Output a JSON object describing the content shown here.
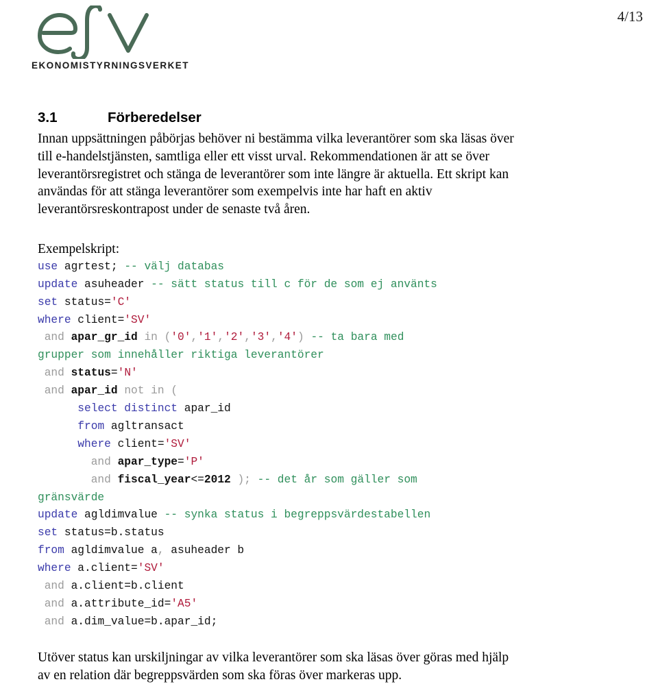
{
  "header": {
    "page_number": "4/13",
    "logo": {
      "mark_text": "esv",
      "wordmark": "EKONOMISTYRNINGSVERKET",
      "color": "#4a6b57"
    }
  },
  "content": {
    "section": {
      "number": "3.1",
      "title": "Förberedelser"
    },
    "intro_paragraph": "Innan uppsättningen påbörjas behöver ni bestämma vilka leverantörer som ska läsas över till e-handelstjänsten, samtliga eller ett visst urval. Rekommendationen är att se över leverantörsregistret och stänga de leverantörer som inte längre är aktuella. Ett skript kan användas för att stänga leverantörer som exempelvis inte har haft en aktiv leverantörsreskontrapost under de senaste två åren.",
    "script_label": "Exempelskript:",
    "outro_paragraph": "Utöver status kan urskiljningar av vilka leverantörer som ska läsas över göras med hjälp av en relation där begreppsvärden som ska föras över markeras upp.",
    "code": {
      "language": "sql",
      "colors": {
        "keyword": "#3a3aaa",
        "keyword_secondary": "#9a9a9a",
        "identifier": "#111111",
        "string": "#b01c3c",
        "comment": "#2f8f5b",
        "punctuation": "#9a9a9a"
      },
      "lines": [
        [
          {
            "t": "use",
            "c": "kw"
          },
          {
            "t": " agrtest; ",
            "c": "plain"
          },
          {
            "t": "-- välj databas",
            "c": "com"
          }
        ],
        [
          {
            "t": "update",
            "c": "kw"
          },
          {
            "t": " asuheader ",
            "c": "plain"
          },
          {
            "t": "-- sätt status till c för de som ej använts",
            "c": "com"
          }
        ],
        [
          {
            "t": "set",
            "c": "kw"
          },
          {
            "t": " status=",
            "c": "plain"
          },
          {
            "t": "'C'",
            "c": "str"
          }
        ],
        [
          {
            "t": "where",
            "c": "kw"
          },
          {
            "t": " client=",
            "c": "plain"
          },
          {
            "t": "'SV'",
            "c": "str"
          }
        ],
        [
          {
            "t": " ",
            "c": "plain"
          },
          {
            "t": "and",
            "c": "kw2"
          },
          {
            "t": " ",
            "c": "plain"
          },
          {
            "t": "apar_gr_id",
            "c": "id"
          },
          {
            "t": " ",
            "c": "plain"
          },
          {
            "t": "in",
            "c": "kw2"
          },
          {
            "t": " ",
            "c": "plain"
          },
          {
            "t": "(",
            "c": "punct"
          },
          {
            "t": "'0'",
            "c": "str"
          },
          {
            "t": ",",
            "c": "punct"
          },
          {
            "t": "'1'",
            "c": "str"
          },
          {
            "t": ",",
            "c": "punct"
          },
          {
            "t": "'2'",
            "c": "str"
          },
          {
            "t": ",",
            "c": "punct"
          },
          {
            "t": "'3'",
            "c": "str"
          },
          {
            "t": ",",
            "c": "punct"
          },
          {
            "t": "'4'",
            "c": "str"
          },
          {
            "t": ")",
            "c": "punct"
          },
          {
            "t": " ",
            "c": "plain"
          },
          {
            "t": "-- ta bara med",
            "c": "com"
          }
        ],
        [
          {
            "t": "grupper som innehåller riktiga leverantörer",
            "c": "com"
          }
        ],
        [
          {
            "t": " ",
            "c": "plain"
          },
          {
            "t": "and",
            "c": "kw2"
          },
          {
            "t": " ",
            "c": "plain"
          },
          {
            "t": "status",
            "c": "id"
          },
          {
            "t": "=",
            "c": "plain"
          },
          {
            "t": "'N'",
            "c": "str"
          }
        ],
        [
          {
            "t": " ",
            "c": "plain"
          },
          {
            "t": "and",
            "c": "kw2"
          },
          {
            "t": " ",
            "c": "plain"
          },
          {
            "t": "apar_id",
            "c": "id"
          },
          {
            "t": " ",
            "c": "plain"
          },
          {
            "t": "not in",
            "c": "kw2"
          },
          {
            "t": " ",
            "c": "plain"
          },
          {
            "t": "(",
            "c": "punct"
          }
        ],
        [
          {
            "t": "      ",
            "c": "plain"
          },
          {
            "t": "select distinct",
            "c": "kw"
          },
          {
            "t": " apar_id",
            "c": "plain"
          }
        ],
        [
          {
            "t": "      ",
            "c": "plain"
          },
          {
            "t": "from",
            "c": "kw"
          },
          {
            "t": " agltransact",
            "c": "plain"
          }
        ],
        [
          {
            "t": "      ",
            "c": "plain"
          },
          {
            "t": "where",
            "c": "kw"
          },
          {
            "t": " client=",
            "c": "plain"
          },
          {
            "t": "'SV'",
            "c": "str"
          }
        ],
        [
          {
            "t": "        ",
            "c": "plain"
          },
          {
            "t": "and",
            "c": "kw2"
          },
          {
            "t": " ",
            "c": "plain"
          },
          {
            "t": "apar_type",
            "c": "id"
          },
          {
            "t": "=",
            "c": "plain"
          },
          {
            "t": "'P'",
            "c": "str"
          }
        ],
        [
          {
            "t": "        ",
            "c": "plain"
          },
          {
            "t": "and",
            "c": "kw2"
          },
          {
            "t": " ",
            "c": "plain"
          },
          {
            "t": "fiscal_year",
            "c": "id"
          },
          {
            "t": "<=",
            "c": "plain"
          },
          {
            "t": "2012",
            "c": "num"
          },
          {
            "t": " ",
            "c": "plain"
          },
          {
            "t": ");",
            "c": "punct"
          },
          {
            "t": " ",
            "c": "plain"
          },
          {
            "t": "-- det år som gäller som",
            "c": "com"
          }
        ],
        [
          {
            "t": "gränsvärde",
            "c": "com"
          }
        ],
        [
          {
            "t": "update",
            "c": "kw"
          },
          {
            "t": " agldimvalue ",
            "c": "plain"
          },
          {
            "t": "-- synka status i begreppsvärdestabellen",
            "c": "com"
          }
        ],
        [
          {
            "t": "set",
            "c": "kw"
          },
          {
            "t": " status=b.status",
            "c": "plain"
          }
        ],
        [
          {
            "t": "from",
            "c": "kw"
          },
          {
            "t": " agldimvalue a",
            "c": "plain"
          },
          {
            "t": ",",
            "c": "punct"
          },
          {
            "t": " asuheader b",
            "c": "plain"
          }
        ],
        [
          {
            "t": "where",
            "c": "kw"
          },
          {
            "t": " a.client=",
            "c": "plain"
          },
          {
            "t": "'SV'",
            "c": "str"
          }
        ],
        [
          {
            "t": " ",
            "c": "plain"
          },
          {
            "t": "and",
            "c": "kw2"
          },
          {
            "t": " ",
            "c": "plain"
          },
          {
            "t": "a.client=b.client",
            "c": "plain"
          }
        ],
        [
          {
            "t": " ",
            "c": "plain"
          },
          {
            "t": "and",
            "c": "kw2"
          },
          {
            "t": " ",
            "c": "plain"
          },
          {
            "t": "a.attribute_id=",
            "c": "plain"
          },
          {
            "t": "'A5'",
            "c": "str"
          }
        ],
        [
          {
            "t": " ",
            "c": "plain"
          },
          {
            "t": "and",
            "c": "kw2"
          },
          {
            "t": " ",
            "c": "plain"
          },
          {
            "t": "a.dim_value=b.apar_id;",
            "c": "plain"
          }
        ]
      ]
    }
  }
}
